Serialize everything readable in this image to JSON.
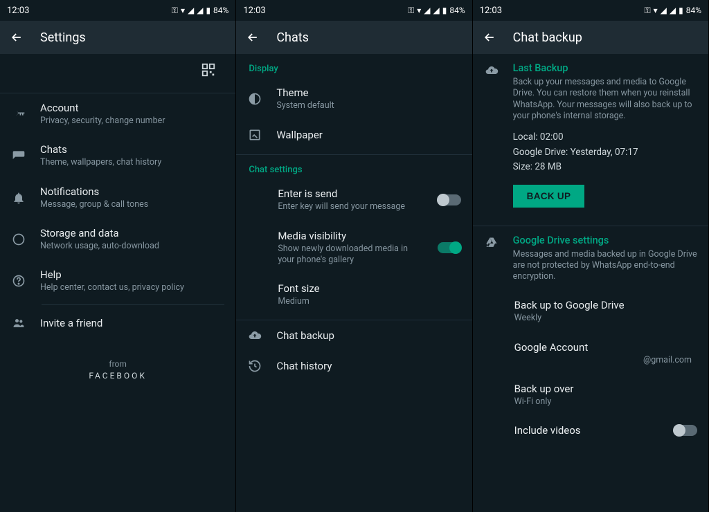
{
  "status": {
    "time": "12:03",
    "battery": "84%"
  },
  "screen1": {
    "title": "Settings",
    "items": [
      {
        "title": "Account",
        "sub": "Privacy, security, change number"
      },
      {
        "title": "Chats",
        "sub": "Theme, wallpapers, chat history"
      },
      {
        "title": "Notifications",
        "sub": "Message, group & call tones"
      },
      {
        "title": "Storage and data",
        "sub": "Network usage, auto-download"
      },
      {
        "title": "Help",
        "sub": "Help center, contact us, privacy policy"
      },
      {
        "title": "Invite a friend"
      }
    ],
    "from": "from",
    "facebook": "FACEBOOK"
  },
  "screen2": {
    "title": "Chats",
    "display_header": "Display",
    "theme": {
      "title": "Theme",
      "sub": "System default"
    },
    "wallpaper": {
      "title": "Wallpaper"
    },
    "chat_settings_header": "Chat settings",
    "enter_send": {
      "title": "Enter is send",
      "sub": "Enter key will send your message"
    },
    "media_vis": {
      "title": "Media visibility",
      "sub": "Show newly downloaded media in your phone's gallery"
    },
    "font_size": {
      "title": "Font size",
      "sub": "Medium"
    },
    "chat_backup": {
      "title": "Chat backup"
    },
    "chat_history": {
      "title": "Chat history"
    }
  },
  "screen3": {
    "title": "Chat backup",
    "last_backup_header": "Last Backup",
    "last_backup_desc": "Back up your messages and media to Google Drive. You can restore them when you reinstall WhatsApp. Your messages will also back up to your phone's internal storage.",
    "local": "Local: 02:00",
    "gdrive_time": "Google Drive: Yesterday, 07:17",
    "size": "Size: 28 MB",
    "backup_btn": "BACK UP",
    "gdrive_header": "Google Drive settings",
    "gdrive_desc": "Messages and media backed up in Google Drive are not protected by WhatsApp end-to-end encryption.",
    "backup_to": {
      "title": "Back up to Google Drive",
      "sub": "Weekly"
    },
    "account": {
      "title": "Google Account",
      "sub": "@gmail.com"
    },
    "backup_over": {
      "title": "Back up over",
      "sub": "Wi-Fi only"
    },
    "include_videos": {
      "title": "Include videos"
    }
  }
}
